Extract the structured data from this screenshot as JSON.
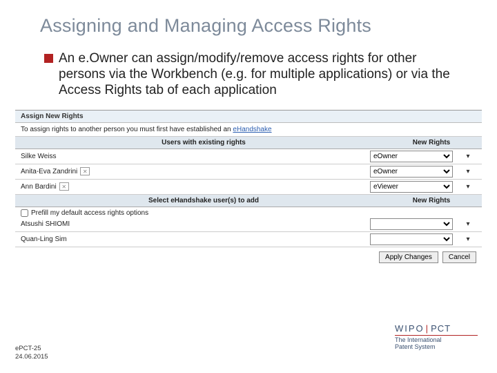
{
  "title": "Assigning and Managing Access Rights",
  "bullet": "An e.Owner can assign/modify/remove access rights for other persons via the Workbench (e.g. for multiple applications) or via the Access Rights tab of each application",
  "panel": {
    "assign_header": "Assign New Rights",
    "instruction_pre": "To assign rights to another person you must first have established an ",
    "instruction_link": "eHandshake",
    "users_header": "Users with existing rights",
    "new_rights_header": "New Rights",
    "select_header": "Select eHandshake user(s) to add",
    "prefill_label": "Prefill my default access rights options",
    "users": [
      {
        "name": "Silke Weiss",
        "role": "eOwner",
        "icon": false
      },
      {
        "name": "Anita-Eva Zandrini",
        "role": "eOwner",
        "icon": true
      },
      {
        "name": "Ann Bardini",
        "role": "eViewer",
        "icon": true
      }
    ],
    "add_users": [
      {
        "name": "Atsushi SHIOMI"
      },
      {
        "name": "Quan-Ling Sim"
      }
    ],
    "apply": "Apply Changes",
    "cancel": "Cancel"
  },
  "footer": {
    "wipo": "WIPO",
    "pct": "PCT",
    "tagline1": "The International",
    "tagline2": "Patent System",
    "slide_id": "ePCT-25",
    "date": "24.06.2015"
  }
}
